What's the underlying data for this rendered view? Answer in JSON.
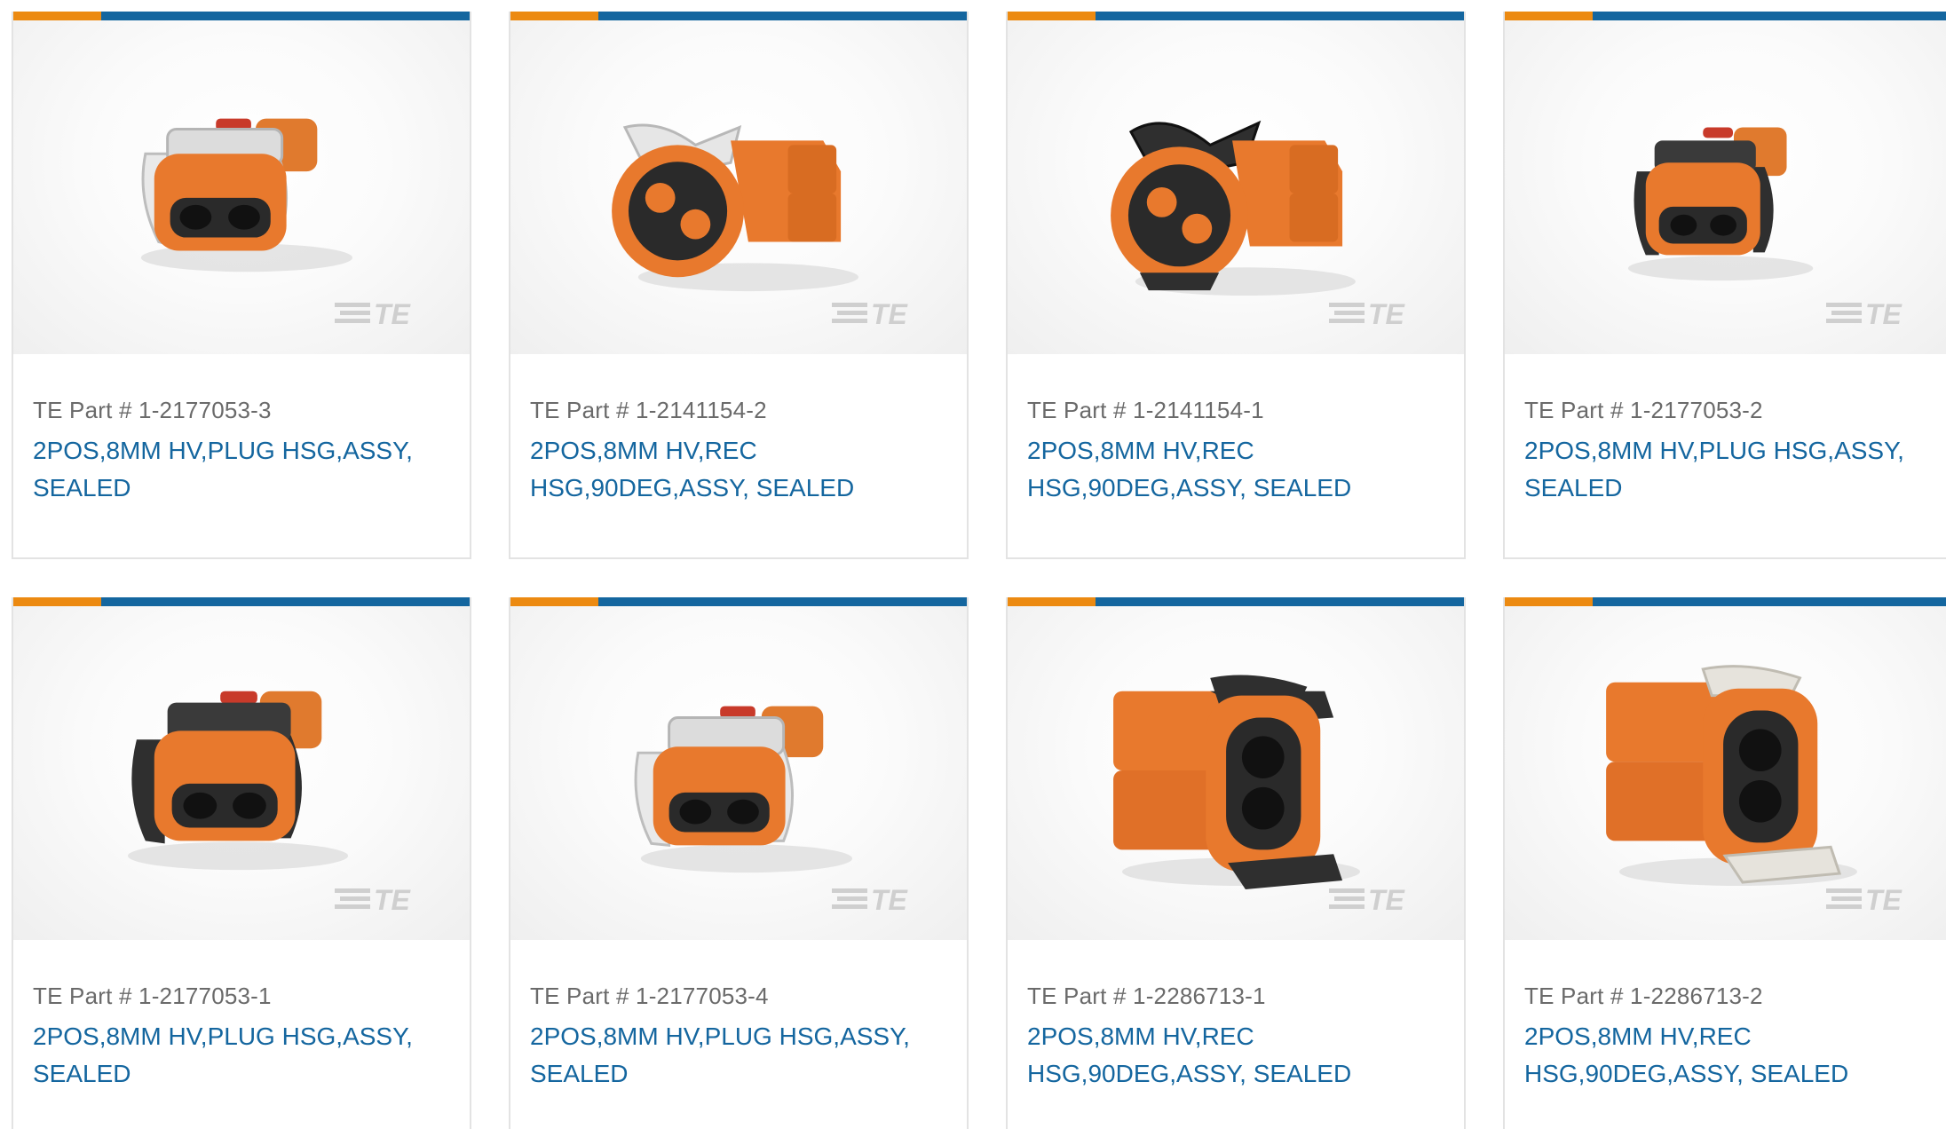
{
  "products": [
    {
      "part_label": "TE Part # 1-2177053-3",
      "description": "2POS,8MM HV,PLUG HSG,ASSY, SEALED",
      "image": "plug-white-clip-connector",
      "logo": "TE"
    },
    {
      "part_label": "TE Part # 1-2141154-2",
      "description": "2POS,8MM HV,REC HSG,90DEG,ASSY, SEALED",
      "image": "receptacle-90deg-white-clip-connector",
      "logo": "TE"
    },
    {
      "part_label": "TE Part # 1-2141154-1",
      "description": "2POS,8MM HV,REC HSG,90DEG,ASSY, SEALED",
      "image": "receptacle-90deg-black-clip-connector",
      "logo": "TE"
    },
    {
      "part_label": "TE Part # 1-2177053-2",
      "description": "2POS,8MM HV,PLUG HSG,ASSY, SEALED",
      "image": "plug-black-clip-connector",
      "logo": "TE"
    },
    {
      "part_label": "TE Part # 1-2177053-1",
      "description": "2POS,8MM HV,PLUG HSG,ASSY, SEALED",
      "image": "plug-black-clip-connector-large",
      "logo": "TE"
    },
    {
      "part_label": "TE Part # 1-2177053-4",
      "description": "2POS,8MM HV,PLUG HSG,ASSY, SEALED",
      "image": "plug-white-clip-connector",
      "logo": "TE"
    },
    {
      "part_label": "TE Part # 1-2286713-1",
      "description": "2POS,8MM HV,REC HSG,90DEG,ASSY, SEALED",
      "image": "receptacle-double-black-clip-connector",
      "logo": "TE"
    },
    {
      "part_label": "TE Part # 1-2286713-2",
      "description": "2POS,8MM HV,REC HSG,90DEG,ASSY, SEALED",
      "image": "receptacle-double-white-clip-connector",
      "logo": "TE"
    }
  ],
  "colors": {
    "accent_orange": "#ec8a11",
    "accent_blue": "#14669f",
    "connector_orange": "#e8792d",
    "link_blue": "#14669f",
    "part_gray": "#6a6a6a"
  }
}
